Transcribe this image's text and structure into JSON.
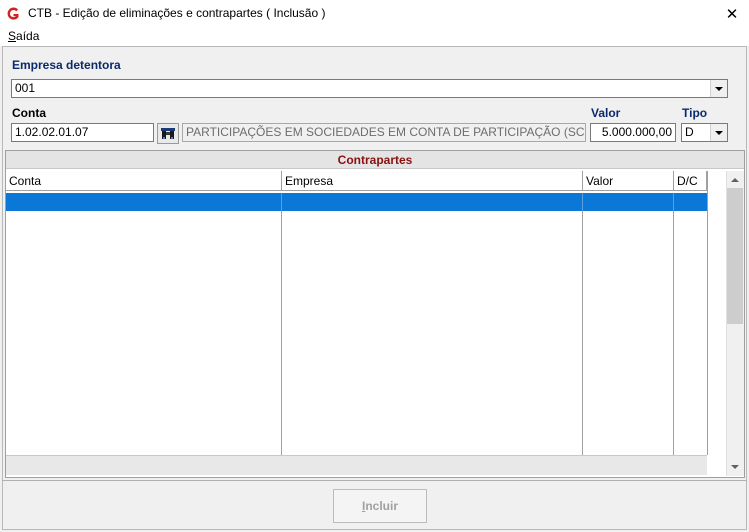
{
  "window": {
    "title": "CTB - Edição de eliminações e contrapartes ( Inclusão )",
    "close_glyph": "✕"
  },
  "menu": {
    "saida_first": "S",
    "saida_rest": "aída"
  },
  "form": {
    "empresa_label": "Empresa detentora",
    "empresa_value": "001",
    "conta_label": "Conta",
    "conta_value": "1.02.02.01.07",
    "conta_description": "PARTICIPAÇÕES EM SOCIEDADES EM CONTA DE PARTICIPAÇÃO (SCP) -",
    "valor_label": "Valor",
    "valor_value": "5.000.000,00",
    "tipo_label": "Tipo",
    "tipo_value": "D"
  },
  "grid": {
    "title": "Contrapartes",
    "columns": [
      "Conta",
      "Empresa",
      "Valor",
      "D/C"
    ]
  },
  "buttons": {
    "incluir_first": "I",
    "incluir_rest": "ncluir"
  },
  "colors": {
    "selection": "#0b78d7",
    "label_navy": "#0b2a6b",
    "grid_title": "#8b1010",
    "app_icon": "#d42020"
  },
  "icons": {
    "app": "app-logo-icon",
    "search": "binoculars-icon",
    "dropdown": "chevron-down-icon"
  }
}
